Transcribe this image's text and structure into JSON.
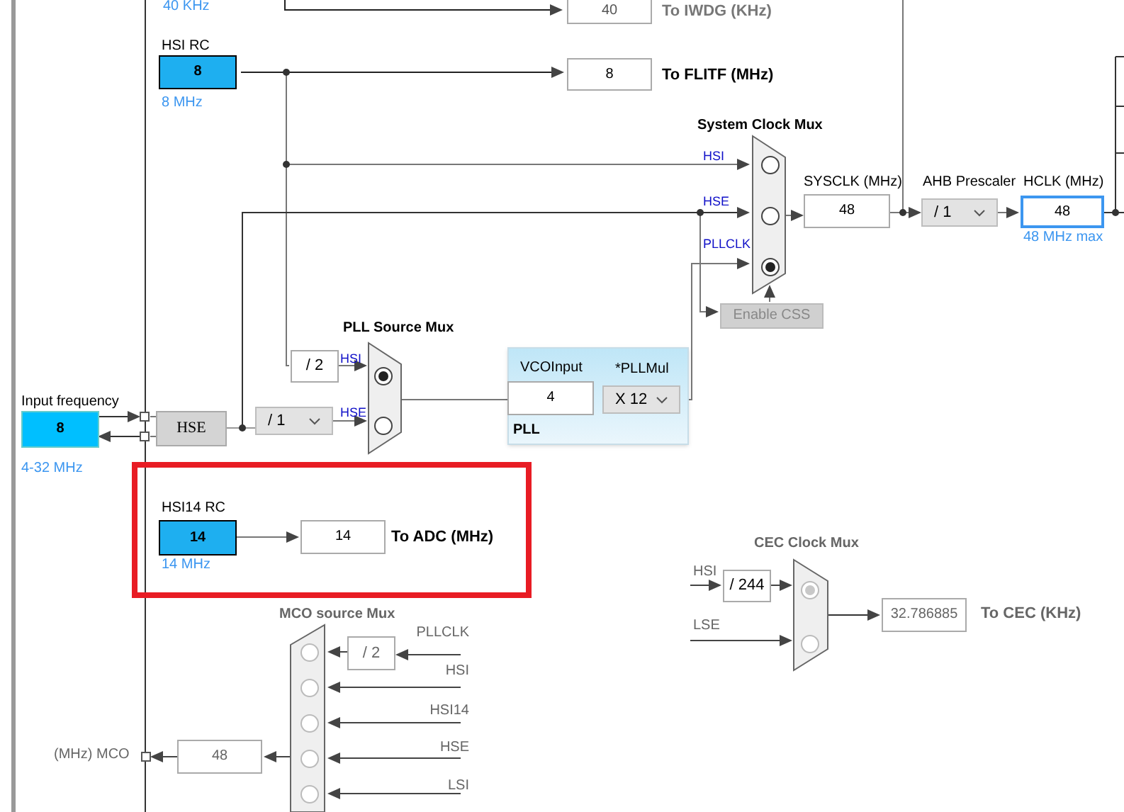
{
  "lsi_rc": {
    "note": "40 KHz"
  },
  "iwdg": {
    "value": "40",
    "label": "To IWDG (KHz)"
  },
  "hsi_rc": {
    "title": "HSI RC",
    "value": "8",
    "note": "8 MHz"
  },
  "flitf": {
    "value": "8",
    "label": "To FLITF (MHz)"
  },
  "system_clock_mux": {
    "title": "System Clock Mux",
    "inputs": [
      {
        "label": "HSI",
        "selected": false
      },
      {
        "label": "HSE",
        "selected": false
      },
      {
        "label": "PLLCLK",
        "selected": true
      }
    ]
  },
  "sysclk": {
    "title": "SYSCLK (MHz)",
    "value": "48"
  },
  "ahb_prescaler": {
    "title": "AHB Prescaler",
    "value": "/ 1"
  },
  "hclk": {
    "title": "HCLK (MHz)",
    "value": "48",
    "note": "48 MHz max"
  },
  "enable_css": {
    "label": "Enable CSS",
    "disabled": true
  },
  "pll_source_mux": {
    "title": "PLL Source Mux",
    "hsi_divider": "/ 2",
    "inputs": [
      {
        "label": "HSI",
        "selected": true
      },
      {
        "label": "HSE",
        "selected": false
      }
    ]
  },
  "hse": {
    "title": "Input frequency",
    "value": "8",
    "note": "4-32 MHz",
    "label": "HSE",
    "divider": "/ 1"
  },
  "pll": {
    "title": "PLL",
    "vco_label": "VCOInput",
    "vco_value": "4",
    "mul_label": "*PLLMul",
    "mul_value": "X 12"
  },
  "hsi14_rc": {
    "title": "HSI14 RC",
    "value": "14",
    "note": "14 MHz",
    "adc_value": "14",
    "adc_label": "To ADC (MHz)"
  },
  "mco_source_mux": {
    "title": "MCO source Mux",
    "disabled": true,
    "pllclk_divider": "/ 2",
    "output_value": "48",
    "output_label": "(MHz) MCO",
    "inputs": [
      {
        "label": "PLLCLK",
        "selected": false
      },
      {
        "label": "HSI",
        "selected": false
      },
      {
        "label": "HSI14",
        "selected": false
      },
      {
        "label": "HSE",
        "selected": false
      },
      {
        "label": "LSI",
        "selected": false
      }
    ]
  },
  "cec_clock_mux": {
    "title": "CEC Clock Mux",
    "disabled": true,
    "hsi_divider": "/ 244",
    "output_value": "32.786885",
    "output_label": "To CEC (KHz)",
    "inputs": [
      {
        "label": "HSI",
        "selected": true
      },
      {
        "label": "LSE",
        "selected": false
      }
    ]
  }
}
